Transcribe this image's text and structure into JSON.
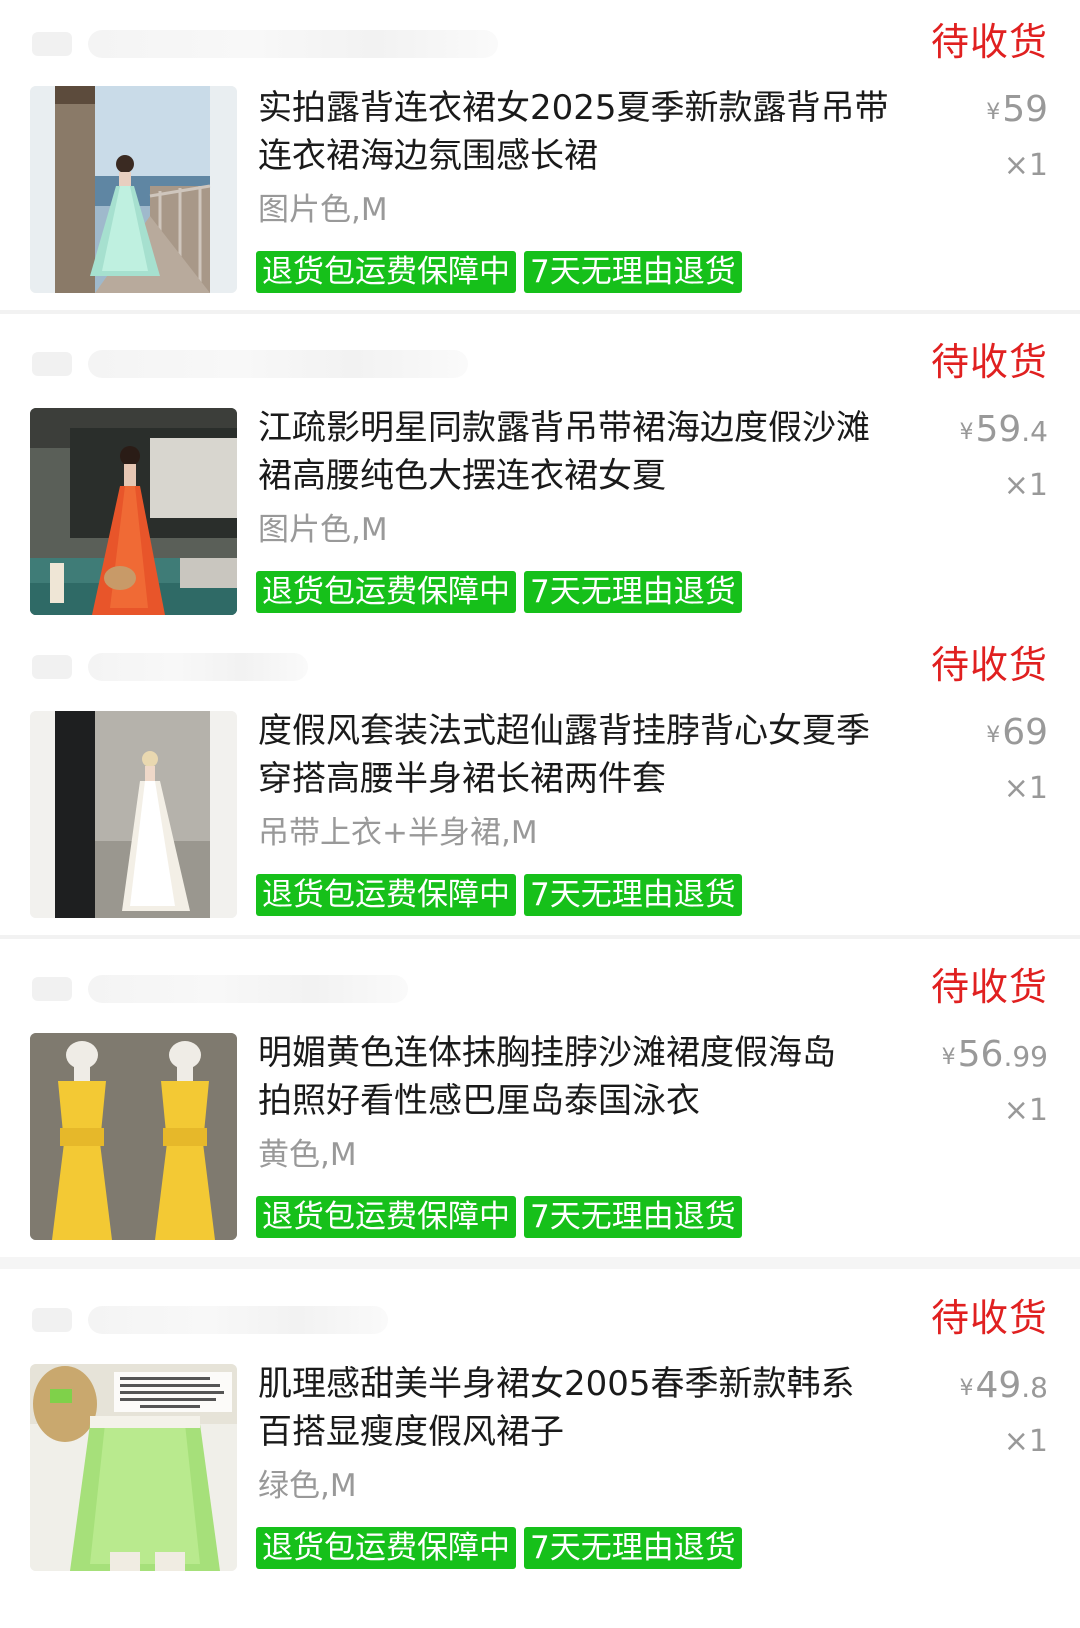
{
  "orders": [
    {
      "status": "待收货",
      "title": "实拍露背连衣裙女2025夏季新款露背吊带连衣裙海边氛围感长裙",
      "spec": "图片色,M",
      "price_currency": "¥",
      "price_int": "59",
      "price_dec": "",
      "qty": "×1",
      "tags": [
        "退货包运费保障中",
        "7天无理由退货"
      ],
      "image_desc": "mint-dress-on-boardwalk"
    },
    {
      "status": "待收货",
      "title": "江疏影明星同款露背吊带裙海边度假沙滩裙高腰纯色大摆连衣裙女夏",
      "spec": "图片色,M",
      "price_currency": "¥",
      "price_int": "59",
      "price_dec": ".4",
      "qty": "×1",
      "tags": [
        "退货包运费保障中",
        "7天无理由退货"
      ],
      "image_desc": "orange-dress-by-pool"
    },
    {
      "status": "待收货",
      "title": "度假风套装法式超仙露背挂脖背心女夏季穿搭高腰半身裙长裙两件套",
      "spec": "吊带上衣+半身裙,M",
      "price_currency": "¥",
      "price_int": "69",
      "price_dec": "",
      "qty": "×1",
      "tags": [
        "退货包运费保障中",
        "7天无理由退货"
      ],
      "image_desc": "white-two-piece-dress"
    },
    {
      "status": "待收货",
      "title": "明媚黄色连体抹胸挂脖沙滩裙度假海岛拍照好看性感巴厘岛泰国泳衣",
      "spec": "黄色,M",
      "price_currency": "¥",
      "price_int": "56",
      "price_dec": ".99",
      "qty": "×1",
      "tags": [
        "退货包运费保障中",
        "7天无理由退货"
      ],
      "image_desc": "yellow-halter-dress-on-mannequins"
    },
    {
      "status": "待收货",
      "title": "肌理感甜美半身裙女2005春季新款韩系百搭显瘦度假风裙子",
      "spec": "绿色,M",
      "price_currency": "¥",
      "price_int": "49",
      "price_dec": ".8",
      "qty": "×1",
      "tags": [
        "退货包运费保障中",
        "7天无理由退货"
      ],
      "image_desc": "green-midi-skirt",
      "image_caption": "这期被问n次的裙子 听说我们都要买绿色ie品 黄色 也很春天 白色基础好配~ 适加入购买清单"
    }
  ],
  "colors": {
    "status_red": "#e02020",
    "tag_green": "#16c01a",
    "muted_gray": "#999999"
  }
}
